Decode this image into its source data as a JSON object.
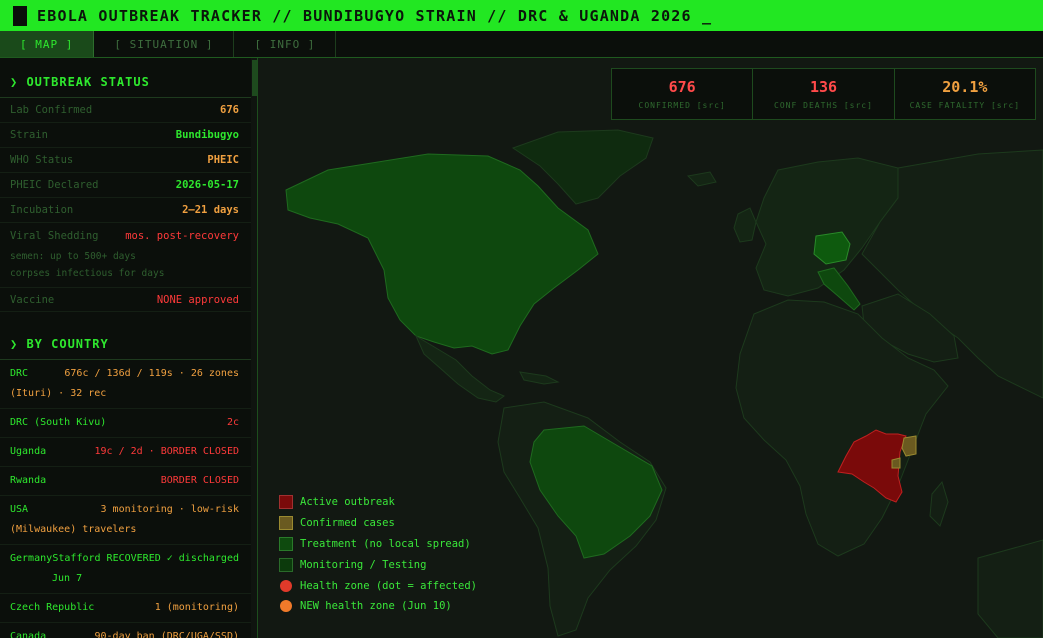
{
  "title": "EBOLA OUTBREAK TRACKER // BUNDIBUGYO STRAIN // DRC & UGANDA 2026 _",
  "tabs": [
    {
      "label": "[ MAP ]",
      "active": true
    },
    {
      "label": "[ SITUATION ]",
      "active": false
    },
    {
      "label": "[ INFO ]",
      "active": false
    }
  ],
  "sidebar": {
    "status_heading": "❯ OUTBREAK STATUS",
    "status": [
      {
        "key": "Lab Confirmed",
        "value": "676",
        "color": "orange"
      },
      {
        "key": "Strain",
        "value": "Bundibugyo",
        "color": "green"
      },
      {
        "key": "WHO Status",
        "value": "PHEIC",
        "color": "orange"
      },
      {
        "key": "PHEIC Declared",
        "value": "2026-05-17",
        "color": "green"
      },
      {
        "key": "Incubation",
        "value": "2–21 days",
        "color": "orange"
      }
    ],
    "shedding": {
      "key": "Viral Shedding",
      "value": "mos. post-recovery",
      "note1": "semen: up to 500+ days",
      "note2": "corpses infectious for days"
    },
    "vaccine": {
      "key": "Vaccine",
      "value": "NONE approved"
    },
    "country_heading": "❯ BY COUNTRY",
    "countries": [
      {
        "name": "DRC",
        "value": "676c / 136d / 119s · 26 zones",
        "cont": "(Ituri) · 32 rec",
        "color": "orange"
      },
      {
        "name": "DRC (South Kivu)",
        "value": "2c",
        "color": "red"
      },
      {
        "name": "Uganda",
        "value": "19c / 2d · BORDER CLOSED",
        "color": "red"
      },
      {
        "name": "Rwanda",
        "value": "BORDER CLOSED",
        "color": "red"
      },
      {
        "name": "USA",
        "value": "3 monitoring · low-risk",
        "cont": "(Milwaukee) travelers",
        "color": "orange"
      },
      {
        "name": "Germany",
        "value": "Stafford RECOVERED ✓ discharged",
        "cont": "Jun 7",
        "color": "green"
      },
      {
        "name": "Czech Republic",
        "value": "1 (monitoring)",
        "color": "orange"
      },
      {
        "name": "Canada",
        "value": "90-day ban (DRC/UGA/SSD)",
        "color": "orange"
      }
    ]
  },
  "stats": [
    {
      "value": "676",
      "label": "CONFIRMED [src]",
      "color": "#ff4a4a"
    },
    {
      "value": "136",
      "label": "CONF DEATHS [src]",
      "color": "#ff4a4a"
    },
    {
      "value": "20.1%",
      "label": "CASE FATALITY [src]",
      "color": "#f0a040"
    }
  ],
  "legend": [
    {
      "label": "Active outbreak",
      "type": "square",
      "color": "#7a0a0a"
    },
    {
      "label": "Confirmed cases",
      "type": "square",
      "color": "#6a5a20"
    },
    {
      "label": "Treatment (no local spread)",
      "type": "square",
      "color": "#0e4a0e"
    },
    {
      "label": "Monitoring / Testing",
      "type": "square",
      "color": "#0c3a0c"
    },
    {
      "label": "Health zone (dot = affected)",
      "type": "dot",
      "color": "#e03a2a"
    },
    {
      "label": "NEW health zone (Jun 10)",
      "type": "dot",
      "color": "#f07a2a"
    }
  ]
}
